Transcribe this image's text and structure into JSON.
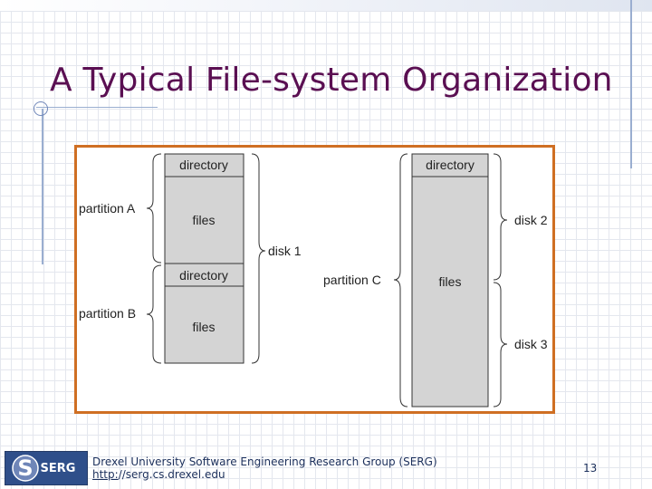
{
  "slide": {
    "title": "A Typical File-system Organization",
    "page_number": "13"
  },
  "diagram": {
    "disk1": {
      "label": "disk 1",
      "partitions": [
        {
          "label": "partition A",
          "directory": "directory",
          "files": "files"
        },
        {
          "label": "partition B",
          "directory": "directory",
          "files": "files"
        }
      ]
    },
    "partition_c": {
      "label": "partition C",
      "directory": "directory",
      "files": "files",
      "disks": [
        "disk 2",
        "disk 3"
      ]
    }
  },
  "footer": {
    "org": "Drexel University Software Engineering Research Group (SERG)",
    "link_protocol": "http:",
    "link_rest": "//serg.cs.drexel.edu",
    "logo_text": "SERG"
  },
  "colors": {
    "title": "#5a0f52",
    "frame_border": "#cf6f23",
    "box_fill": "#d4d4d4",
    "logo_bg": "#2f4f8a"
  }
}
